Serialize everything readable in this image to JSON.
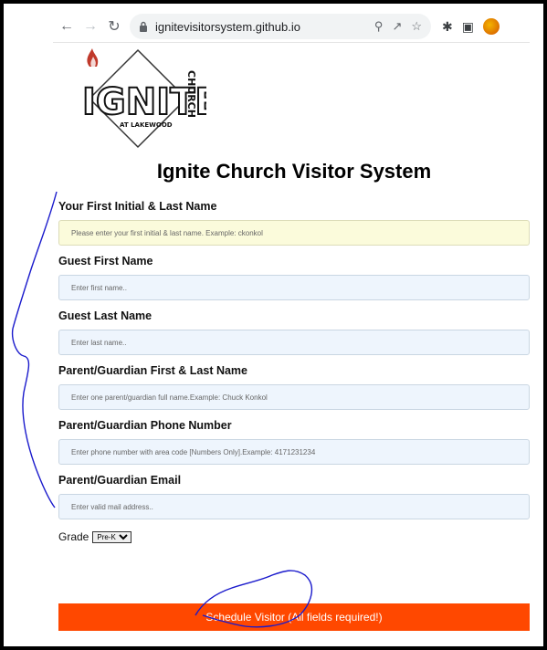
{
  "browser": {
    "url": "ignitevisitorsystem.github.io"
  },
  "logo": {
    "text": "IGNITE",
    "side_text": "CHURCH",
    "sub_text": "AT LAKEWOOD"
  },
  "page": {
    "title": "Ignite Church Visitor System"
  },
  "form": {
    "fields": [
      {
        "label": "Your First Initial & Last Name",
        "placeholder": "Please enter your first initial & last name. Example: ckonkol"
      },
      {
        "label": "Guest First Name",
        "placeholder": "Enter first name.."
      },
      {
        "label": "Guest Last Name",
        "placeholder": "Enter last name.."
      },
      {
        "label": "Parent/Guardian First & Last Name",
        "placeholder": "Enter one parent/guardian full name.Example: Chuck Konkol"
      },
      {
        "label": "Parent/Guardian Phone Number",
        "placeholder": "Enter phone number with area code [Numbers Only].Example: 4171231234"
      },
      {
        "label": "Parent/Guardian Email",
        "placeholder": "Enter valid mail address.."
      }
    ],
    "grade_label": "Grade",
    "grade_selected": "Pre-K",
    "submit_label": "Schedule Visitor (All fields required!)"
  },
  "colors": {
    "accent": "#ff4800",
    "input_bg": "#eef5fd",
    "input_highlight_bg": "#fbfbdb",
    "ink": "#1a1acc"
  }
}
